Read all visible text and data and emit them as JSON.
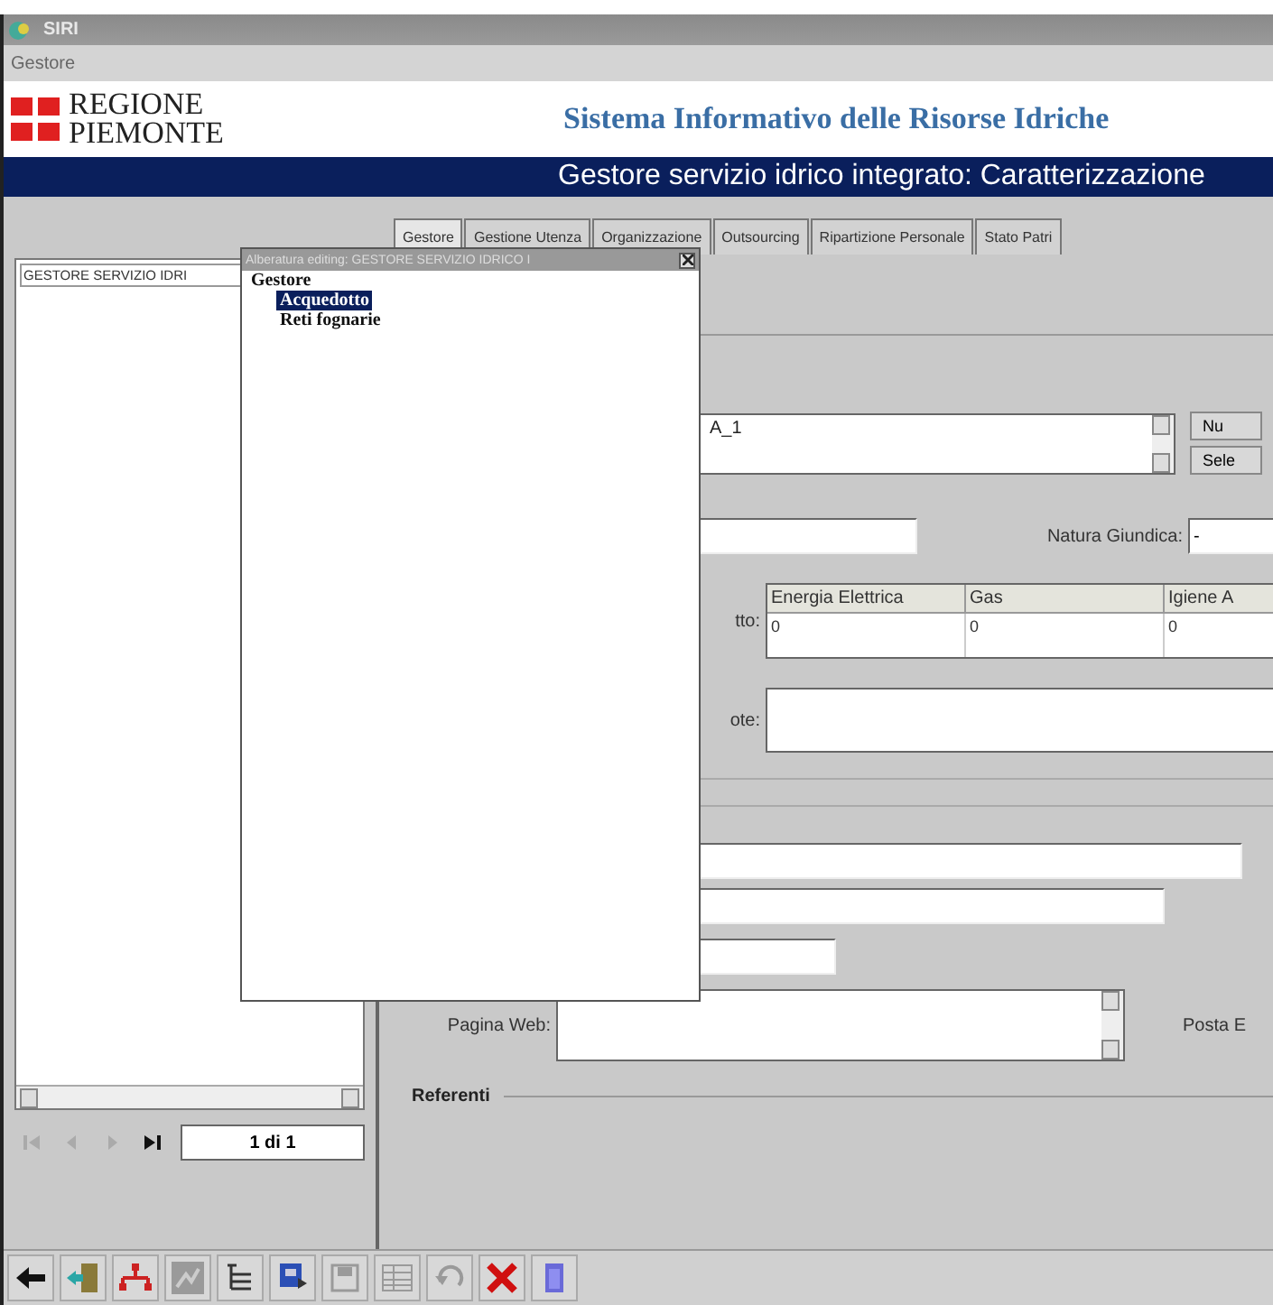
{
  "window": {
    "title": "SIRI"
  },
  "menu": [
    "Gestore"
  ],
  "banner": {
    "logo_line_1": "REGIONE",
    "logo_line_2": "PIEMONTE",
    "system_title": "Sistema Informativo delle Risorse Idriche"
  },
  "page_title": "Gestore servizio idrico integrato: Caratterizzazione",
  "tabs": [
    {
      "label": "Gestore",
      "selected": true
    },
    {
      "label": "Gestione Utenza",
      "selected": false
    },
    {
      "label": "Organizzazione",
      "selected": false
    },
    {
      "label": "Outsourcing",
      "selected": false
    },
    {
      "label": "Ripartizione Personale",
      "selected": false
    },
    {
      "label": "Stato Patri",
      "selected": false
    }
  ],
  "left_panel": {
    "items": [
      {
        "label": "GESTORE SERVIZIO IDRI",
        "selected": false
      }
    ]
  },
  "popup": {
    "title": "Alberatura editing: GESTORE SERVIZIO IDRICO I",
    "tree": [
      {
        "label": "Gestore",
        "children": [
          {
            "label": "Acquedotto",
            "selected": true
          },
          {
            "label": "Reti fognarie",
            "selected": false
          }
        ]
      }
    ]
  },
  "form": {
    "name_value": "A_1",
    "buttons": [
      "Nu",
      "Sele"
    ],
    "natura_label": "Natura Giundica:",
    "natura_value": "-",
    "table_label": "tto:",
    "table": {
      "columns": [
        "Energia Elettrica",
        "Gas",
        "Igiene A"
      ],
      "rows": [
        [
          "0",
          "0",
          "0"
        ]
      ]
    },
    "notes_label": "ote:",
    "web_label": "Pagina Web:",
    "email_label": "Posta E",
    "section": "Referenti"
  },
  "navigator": {
    "buttons": [
      {
        "kind": "first",
        "disabled": true
      },
      {
        "kind": "prev",
        "disabled": true
      },
      {
        "kind": "next",
        "disabled": true
      },
      {
        "kind": "last",
        "disabled": false
      }
    ],
    "position": "1 di 1"
  },
  "toolbar": [
    {
      "kind": "back",
      "disabled": false
    },
    {
      "kind": "exit",
      "disabled": false
    },
    {
      "kind": "network",
      "disabled": false
    },
    {
      "kind": "chart",
      "disabled": true
    },
    {
      "kind": "tree",
      "disabled": false
    },
    {
      "kind": "form",
      "disabled": false
    },
    {
      "kind": "save",
      "disabled": true
    },
    {
      "kind": "grid",
      "disabled": true
    },
    {
      "kind": "undo",
      "disabled": true
    },
    {
      "kind": "delete",
      "disabled": false
    },
    {
      "kind": "trash",
      "disabled": false
    }
  ]
}
